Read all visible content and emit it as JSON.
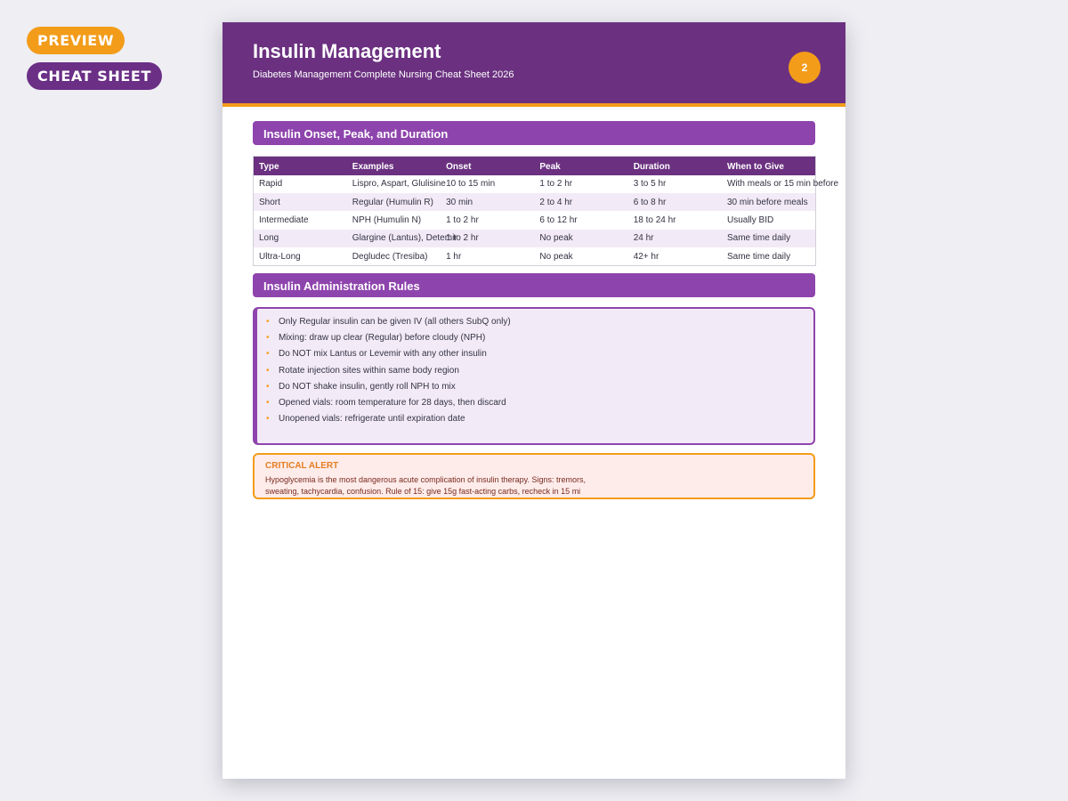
{
  "badges": {
    "preview": "PREVIEW",
    "cheat_sheet": "CHEAT SHEET"
  },
  "header": {
    "title": "Insulin Management",
    "subtitle": "Diabetes Management Complete Nursing Cheat Sheet 2026",
    "page_number": "2"
  },
  "colors": {
    "header_purple": "#6b3180",
    "section_purple": "#8e44ad",
    "accent_orange": "#f39c1a",
    "row_tint": "#f3eaf7",
    "alert_bg": "#fdecea"
  },
  "onset_section": {
    "title": "Insulin Onset, Peak, and Duration",
    "columns": [
      "Type",
      "Examples",
      "Onset",
      "Peak",
      "Duration",
      "When to Give"
    ],
    "rows": [
      [
        "Rapid",
        "Lispro, Aspart, Glulisine",
        "10 to 15 min",
        "1 to 2 hr",
        "3 to 5 hr",
        "With meals or 15 min before"
      ],
      [
        "Short",
        "Regular (Humulin R)",
        "30 min",
        "2 to 4 hr",
        "6 to 8 hr",
        "30 min before meals"
      ],
      [
        "Intermediate",
        "NPH (Humulin N)",
        "1 to 2 hr",
        "6 to 12 hr",
        "18 to 24 hr",
        "Usually BID"
      ],
      [
        "Long",
        "Glargine (Lantus), Detemir",
        "1 to 2 hr",
        "No peak",
        "24 hr",
        "Same time daily"
      ],
      [
        "Ultra-Long",
        "Degludec (Tresiba)",
        "1 hr",
        "No peak",
        "42+ hr",
        "Same time daily"
      ]
    ]
  },
  "rules_section": {
    "title": "Insulin Administration Rules",
    "bullet_symbol": "•",
    "items": [
      "Only Regular insulin can be given IV (all others SubQ only)",
      "Mixing: draw up clear (Regular) before cloudy (NPH)",
      "Do NOT mix Lantus or Levemir with any other insulin",
      "Rotate injection sites within same body region",
      "Do NOT shake insulin, gently roll NPH to mix",
      "Opened vials: room temperature for 28 days, then discard",
      "Unopened vials: refrigerate until expiration date"
    ]
  },
  "alert": {
    "title": "CRITICAL ALERT",
    "text": "Hypoglycemia is the most dangerous acute complication of insulin therapy. Signs: tremors, sweating, tachycardia, confusion. Rule of 15: give 15g fast-acting carbs, recheck in 15 mi"
  }
}
